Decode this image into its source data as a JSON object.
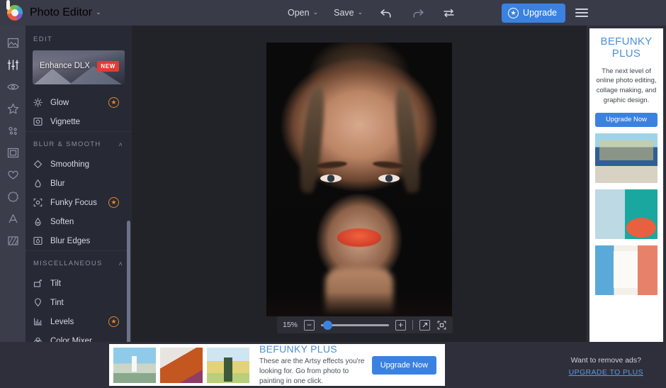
{
  "topbar": {
    "logo_icon": "befunky-logo-icon",
    "app_title": "Photo Editor",
    "caret": "⌄",
    "open_label": "Open",
    "save_label": "Save",
    "undo_icon": "undo-arrow-icon",
    "redo_icon": "redo-arrow-icon",
    "swap_icon": "swap-compare-icon",
    "upgrade_label": "Upgrade",
    "upgrade_star": "★",
    "menu_icon": "hamburger-menu-icon",
    "accent_blue": "#3b82e0",
    "bar_bg": "#393b49"
  },
  "rail": {
    "items": [
      {
        "icon": "image-icon",
        "active": false
      },
      {
        "icon": "sliders-edit-icon",
        "active": true
      },
      {
        "icon": "eye-touchup-icon",
        "active": false
      },
      {
        "icon": "star-effects-icon",
        "active": false
      },
      {
        "icon": "artsy-dots-icon",
        "active": false
      },
      {
        "icon": "frames-icon",
        "active": false
      },
      {
        "icon": "heart-overlays-icon",
        "active": false
      },
      {
        "icon": "badge-graphics-icon",
        "active": false
      },
      {
        "icon": "text-a-icon",
        "active": false
      },
      {
        "icon": "texture-icon",
        "active": false
      }
    ]
  },
  "panel": {
    "header": "EDIT",
    "banner": {
      "label": "Enhance DLX",
      "badge": "NEW"
    },
    "top_items": [
      {
        "label": "Glow",
        "icon": "glow-sun-icon",
        "pro": true
      },
      {
        "label": "Vignette",
        "icon": "vignette-square-icon",
        "pro": false
      }
    ],
    "groups": [
      {
        "title": "BLUR & SMOOTH",
        "chevron": "˄",
        "items": [
          {
            "label": "Smoothing",
            "icon": "diamond-smoothing-icon",
            "pro": false
          },
          {
            "label": "Blur",
            "icon": "droplet-blur-icon",
            "pro": false
          },
          {
            "label": "Funky Focus",
            "icon": "focus-target-icon",
            "pro": true
          },
          {
            "label": "Soften",
            "icon": "soften-icon",
            "pro": false
          },
          {
            "label": "Blur Edges",
            "icon": "blur-edges-icon",
            "pro": false
          }
        ]
      },
      {
        "title": "MISCELLANEOUS",
        "chevron": "˄",
        "items": [
          {
            "label": "Tilt",
            "icon": "tilt-icon",
            "pro": false
          },
          {
            "label": "Tint",
            "icon": "tint-drop-icon",
            "pro": false
          },
          {
            "label": "Levels",
            "icon": "levels-bars-icon",
            "pro": true
          },
          {
            "label": "Color Mixer",
            "icon": "color-mixer-icon",
            "pro": false
          }
        ]
      }
    ],
    "pro_star": "★",
    "pro_color": "#e0892a"
  },
  "canvas": {
    "photo_alt": "portrait-photo-woman",
    "zoom": {
      "level": "15%",
      "minus": "−",
      "plus": "+",
      "expand_icon": "expand-arrow-icon",
      "fit_icon": "fit-to-screen-icon",
      "slider_percent": 8
    }
  },
  "right_ad": {
    "title_line1": "BEFUNKY",
    "title_line2": "PLUS",
    "description": "The next level of online photo editing, collage making, and graphic design.",
    "button_label": "Upgrade Now",
    "thumbs": [
      "vintage-car-photo",
      "collage-photo",
      "templates-photo"
    ]
  },
  "bottom_ad": {
    "thumbs": [
      "lighthouse-thumb",
      "portrait-artsy-thumb",
      "road-landscape-thumb"
    ],
    "title": "BEFUNKY PLUS",
    "description": "These are the Artsy effects you're looking for. Go from photo to painting in one click.",
    "button_label": "Upgrade Now",
    "remove_ads_question": "Want to remove ads?",
    "remove_ads_link": "UPGRADE TO PLUS"
  }
}
